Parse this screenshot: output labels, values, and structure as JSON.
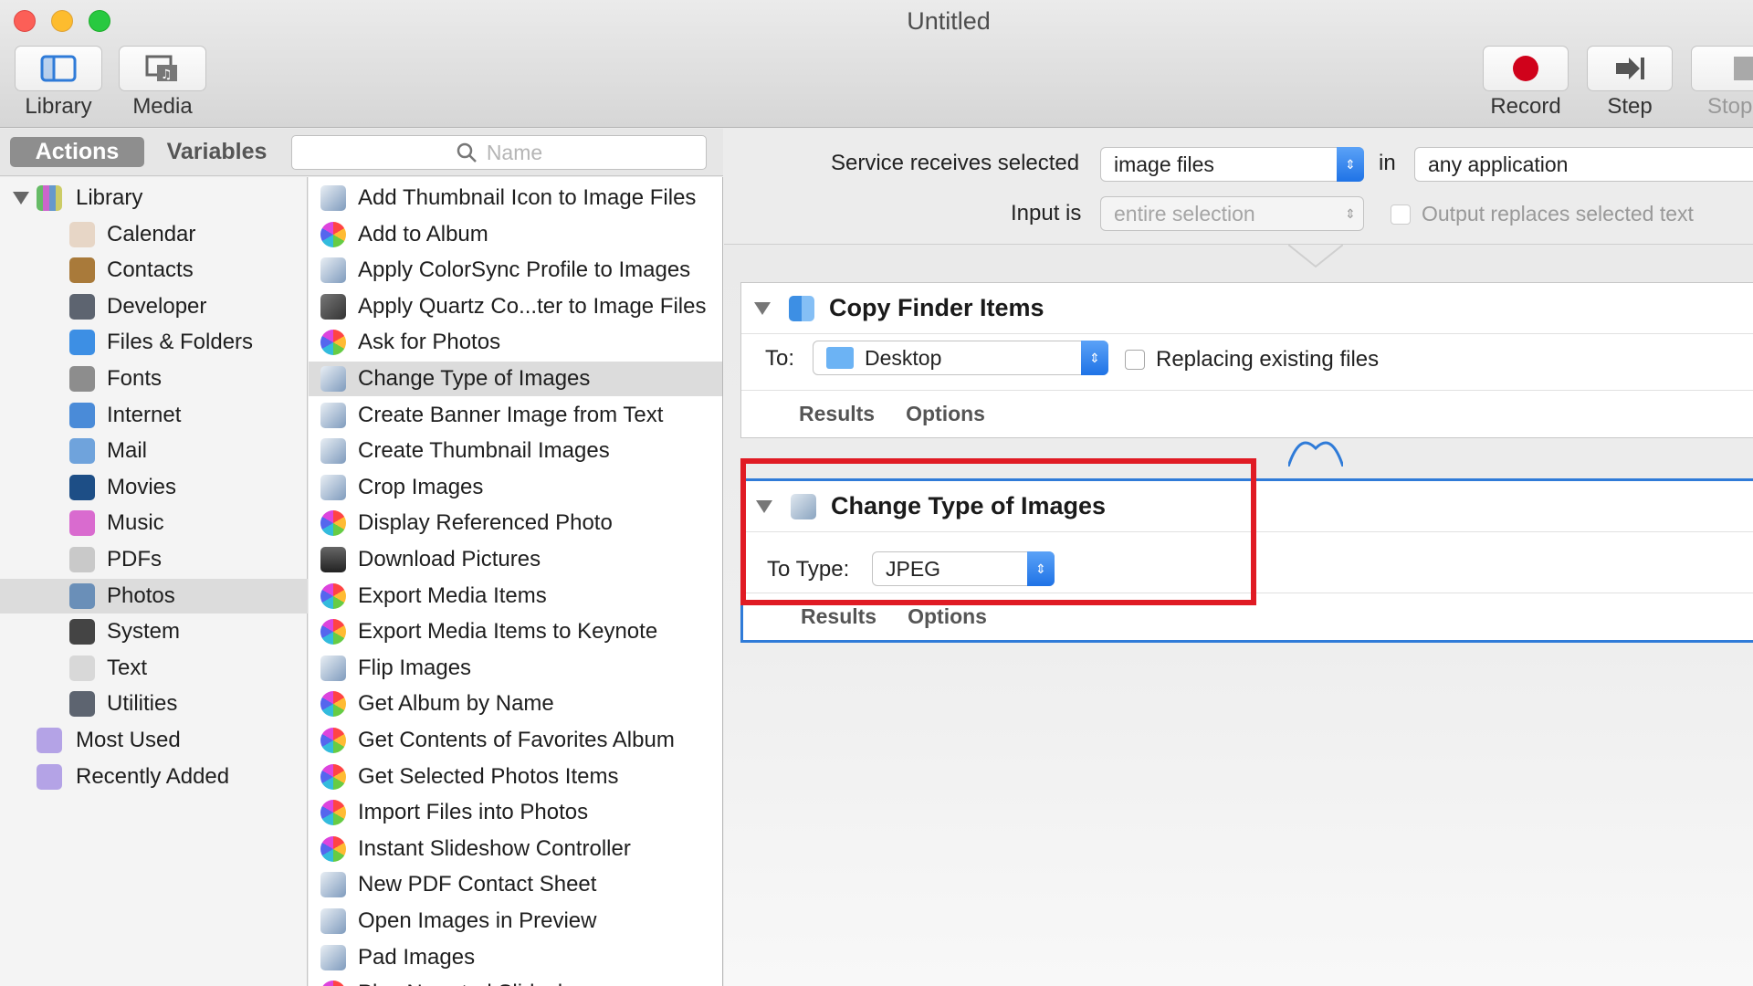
{
  "window": {
    "title": "Untitled"
  },
  "toolbar": {
    "library_label": "Library",
    "media_label": "Media",
    "record_label": "Record",
    "step_label": "Step",
    "stop_label": "Stop"
  },
  "left_header": {
    "actions_tab": "Actions",
    "variables_tab": "Variables",
    "search_placeholder": "Name"
  },
  "library": {
    "root": "Library",
    "items": [
      {
        "label": "Calendar",
        "icon": "calendar-icon",
        "color": "#e7d6c6"
      },
      {
        "label": "Contacts",
        "icon": "contacts-icon",
        "color": "#a97a3a"
      },
      {
        "label": "Developer",
        "icon": "developer-icon",
        "color": "#5d6470"
      },
      {
        "label": "Files & Folders",
        "icon": "finder-icon",
        "color": "#3d8fe4"
      },
      {
        "label": "Fonts",
        "icon": "fonts-icon",
        "color": "#8d8d8d"
      },
      {
        "label": "Internet",
        "icon": "internet-icon",
        "color": "#4a8bd8"
      },
      {
        "label": "Mail",
        "icon": "mail-icon",
        "color": "#6fa3dc"
      },
      {
        "label": "Movies",
        "icon": "movies-icon",
        "color": "#1d4e86"
      },
      {
        "label": "Music",
        "icon": "music-icon",
        "color": "#d96bcf"
      },
      {
        "label": "PDFs",
        "icon": "pdf-icon",
        "color": "#c9c9c9"
      },
      {
        "label": "Photos",
        "icon": "photos-icon",
        "color": "#6a8fb8"
      },
      {
        "label": "System",
        "icon": "system-icon",
        "color": "#444444"
      },
      {
        "label": "Text",
        "icon": "text-icon",
        "color": "#d8d8d8"
      },
      {
        "label": "Utilities",
        "icon": "utilities-icon",
        "color": "#5d6470"
      }
    ],
    "selected": "Photos",
    "smart_groups": [
      {
        "label": "Most Used",
        "icon": "smart-folder-icon"
      },
      {
        "label": "Recently Added",
        "icon": "smart-folder-icon"
      }
    ]
  },
  "actions": {
    "items": [
      "Add Thumbnail Icon to Image Files",
      "Add to Album",
      "Apply ColorSync Profile to Images",
      "Apply Quartz Co...ter to Image Files",
      "Ask for Photos",
      "Change Type of Images",
      "Create Banner Image from Text",
      "Create Thumbnail Images",
      "Crop Images",
      "Display Referenced Photo",
      "Download Pictures",
      "Export Media Items",
      "Export Media Items to Keynote",
      "Flip Images",
      "Get Album by Name",
      "Get Contents of Favorites Album",
      "Get Selected Photos Items",
      "Import Files into Photos",
      "Instant Slideshow Controller",
      "New PDF Contact Sheet",
      "Open Images in Preview",
      "Pad Images",
      "Play Narrated Slideshow"
    ],
    "icon_kinds": [
      "preview",
      "photos",
      "preview",
      "tools",
      "photos",
      "preview",
      "preview",
      "preview",
      "preview",
      "photos",
      "download",
      "photos",
      "photos",
      "preview",
      "photos",
      "photos",
      "photos",
      "photos",
      "photos",
      "preview",
      "preview",
      "preview",
      "photos"
    ],
    "selected_index": 5
  },
  "service": {
    "receives_label": "Service receives selected",
    "receives_value": "image files",
    "in_label": "in",
    "in_value": "any application",
    "input_label": "Input is",
    "input_value": "entire selection",
    "output_label": "Output replaces selected text"
  },
  "card1": {
    "title": "Copy Finder Items",
    "to_label": "To:",
    "to_value": "Desktop",
    "replace_label": "Replacing existing files",
    "results": "Results",
    "options": "Options"
  },
  "card2": {
    "title": "Change Type of Images",
    "type_label": "To Type:",
    "type_value": "JPEG",
    "results": "Results",
    "options": "Options"
  },
  "colors": {
    "highlight": "#e01b24",
    "accent": "#2f7bd8",
    "record": "#d0021b"
  }
}
